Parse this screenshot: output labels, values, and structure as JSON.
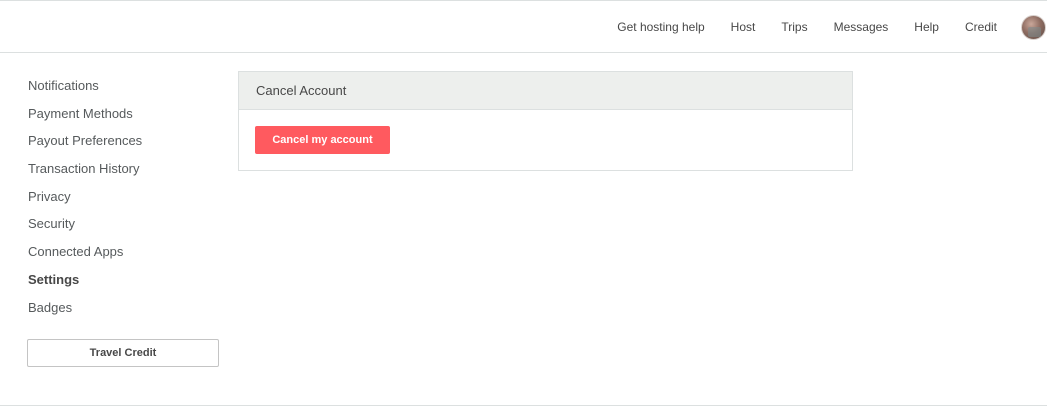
{
  "header": {
    "nav": [
      {
        "label": "Get hosting help"
      },
      {
        "label": "Host"
      },
      {
        "label": "Trips"
      },
      {
        "label": "Messages"
      },
      {
        "label": "Help"
      },
      {
        "label": "Credit"
      }
    ],
    "avatar_icon": "user-avatar"
  },
  "sidebar": {
    "items": [
      {
        "label": "Notifications"
      },
      {
        "label": "Payment Methods"
      },
      {
        "label": "Payout Preferences"
      },
      {
        "label": "Transaction History"
      },
      {
        "label": "Privacy"
      },
      {
        "label": "Security"
      },
      {
        "label": "Connected Apps"
      },
      {
        "label": "Settings",
        "active": true
      },
      {
        "label": "Badges"
      }
    ],
    "travel_credit_label": "Travel Credit"
  },
  "panel": {
    "title": "Cancel Account",
    "cancel_button_label": "Cancel my account"
  },
  "colors": {
    "accent": "#ff5a5f",
    "panel_header_bg": "#edefed",
    "border": "#dce0e0",
    "text": "#484848"
  }
}
